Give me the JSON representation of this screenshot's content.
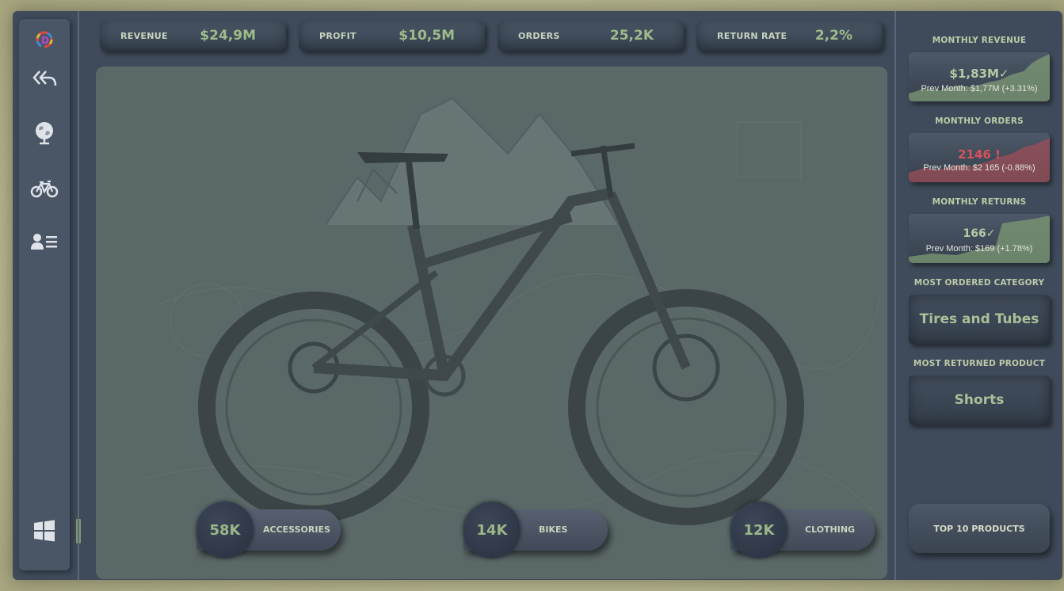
{
  "colors": {
    "accent_green": "#9dbb8a",
    "alert_red": "#c65a62",
    "frame_bg": "#3f4b5a",
    "title_text": "#bccaa7"
  },
  "sidebar": {
    "items": [
      {
        "icon": "app-logo-icon"
      },
      {
        "icon": "back-arrows-icon"
      },
      {
        "icon": "globe-icon"
      },
      {
        "icon": "bike-icon"
      },
      {
        "icon": "customer-list-icon"
      },
      {
        "icon": "windows-icon"
      }
    ]
  },
  "kpis": [
    {
      "label": "REVENUE",
      "value": "$24,9M"
    },
    {
      "label": "PROFIT",
      "value": "$10,5M"
    },
    {
      "label": "ORDERS",
      "value": "25,2K"
    },
    {
      "label": "RETURN RATE",
      "value": "2,2%"
    }
  ],
  "categories": [
    {
      "value": "58K",
      "label": "ACCESSORIES"
    },
    {
      "value": "14K",
      "label": "BIKES"
    },
    {
      "value": "12K",
      "label": "CLOTHING"
    }
  ],
  "right_panel": {
    "monthly_revenue": {
      "title": "MONTHLY REVENUE",
      "value": "$1,83M",
      "status_icon": "✓",
      "sub": "Prev Month: $1,77M (+3.31%)"
    },
    "monthly_orders": {
      "title": "MONTHLY  ORDERS",
      "value": "2146",
      "status_icon": "!",
      "sub": "Prev Month: $2 165 (-0.88%)"
    },
    "monthly_returns": {
      "title": "MONTHLY RETURNS",
      "value": "166",
      "status_icon": "✓",
      "sub": "Prev Month: $169 (+1.78%)"
    },
    "most_ordered_category": {
      "title": "MOST ORDERED CATEGORY",
      "value": "Tires and Tubes"
    },
    "most_returned_product": {
      "title": "MOST RETURNED PRODUCT",
      "value": "Shorts"
    },
    "top10_button": "TOP 10 PRODUCTS"
  }
}
